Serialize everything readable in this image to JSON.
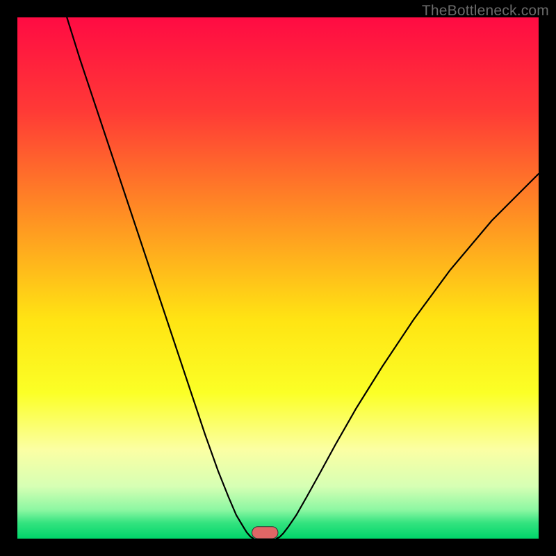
{
  "watermark": "TheBottleneck.com",
  "chart_data": {
    "type": "line",
    "title": "",
    "xlabel": "",
    "ylabel": "",
    "xlim": [
      0,
      100
    ],
    "ylim": [
      0,
      100
    ],
    "background_gradient": {
      "stops": [
        {
          "offset": 0.0,
          "color": "#ff0b43"
        },
        {
          "offset": 0.18,
          "color": "#ff3a36"
        },
        {
          "offset": 0.38,
          "color": "#ff8f23"
        },
        {
          "offset": 0.58,
          "color": "#ffe413"
        },
        {
          "offset": 0.72,
          "color": "#fbff26"
        },
        {
          "offset": 0.83,
          "color": "#fbffa4"
        },
        {
          "offset": 0.9,
          "color": "#d6ffb4"
        },
        {
          "offset": 0.945,
          "color": "#8cf7a2"
        },
        {
          "offset": 0.97,
          "color": "#33e37f"
        },
        {
          "offset": 1.0,
          "color": "#00d56a"
        }
      ]
    },
    "series": [
      {
        "name": "left-curve",
        "x": [
          9.5,
          12,
          15,
          18,
          21,
          24,
          27,
          30,
          33,
          36,
          38.5,
          40.5,
          42,
          43.2,
          44,
          44.7,
          45.3
        ],
        "y": [
          100,
          92,
          83,
          74,
          65,
          56,
          47,
          38,
          29,
          20,
          13,
          8,
          4.5,
          2.5,
          1.2,
          0.4,
          0
        ]
      },
      {
        "name": "right-curve",
        "x": [
          49.7,
          50.3,
          51,
          52,
          53.5,
          55.5,
          58,
          61,
          65,
          70,
          76,
          83,
          91,
          100
        ],
        "y": [
          0,
          0.3,
          1,
          2.3,
          4.5,
          8,
          12.5,
          18,
          25,
          33,
          42,
          51.5,
          61,
          70
        ]
      }
    ],
    "marker": {
      "name": "bottleneck-marker",
      "x_center": 47.5,
      "width": 5.0,
      "height": 2.3,
      "corner_radius": 1.15,
      "fill": "#e06666",
      "stroke": "#333333"
    }
  }
}
